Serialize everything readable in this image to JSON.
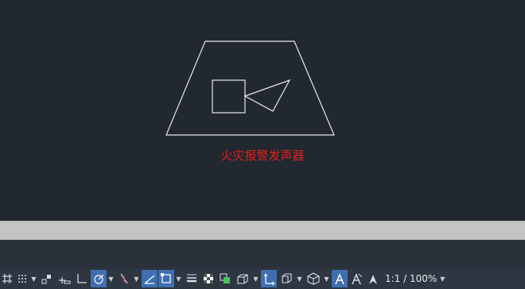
{
  "drawing": {
    "block_label": "火灾报警发声器",
    "label_color": "#e0201a",
    "line_color": "#e8e8e8"
  },
  "statusbar": {
    "scale_text": "1:1 / 100%",
    "dropdown_glyph": "▼",
    "active_color": "#3f6fb0",
    "buttons": [
      {
        "name": "grid-icon",
        "active": false
      },
      {
        "name": "snap-mode-icon",
        "active": false
      },
      {
        "name": "infer-constraints-icon",
        "active": false
      },
      {
        "name": "dynamic-input-icon",
        "active": false
      },
      {
        "name": "ortho-mode-icon",
        "active": false
      },
      {
        "name": "polar-tracking-icon",
        "active": true
      },
      {
        "name": "isometric-drafting-icon",
        "active": false
      },
      {
        "name": "object-snap-tracking-icon",
        "active": true
      },
      {
        "name": "object-snap-icon",
        "active": true
      },
      {
        "name": "lineweight-icon",
        "active": false
      },
      {
        "name": "transparency-icon",
        "active": false
      },
      {
        "name": "selection-cycling-icon",
        "active": false
      },
      {
        "name": "3d-object-snap-icon",
        "active": false
      },
      {
        "name": "dynamic-ucs-icon",
        "active": true
      },
      {
        "name": "selection-filter-icon",
        "active": false
      },
      {
        "name": "gizmo-icon",
        "active": false
      },
      {
        "name": "annotation-visibility-icon",
        "active": true
      },
      {
        "name": "auto-scale-icon",
        "active": false
      },
      {
        "name": "annotation-scale-icon",
        "active": false
      }
    ]
  }
}
